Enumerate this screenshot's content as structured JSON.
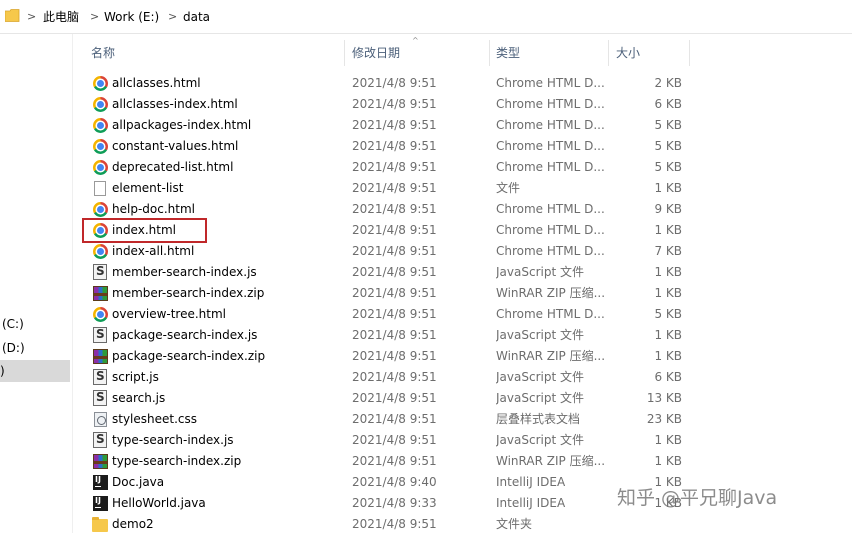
{
  "address_bar": {
    "crumbs": [
      "此电脑",
      "Work (E:)",
      "data"
    ],
    "separator": ">"
  },
  "nav_pane": {
    "items": [
      {
        "label": "(C:)",
        "selected": false
      },
      {
        "label": " (D:)",
        "selected": false
      },
      {
        "label": ")",
        "selected": true
      }
    ]
  },
  "columns": {
    "name": "名称",
    "date": "修改日期",
    "type": "类型",
    "size": "大小",
    "sort_indicator": "^"
  },
  "files": [
    {
      "name": "allclasses.html",
      "date": "2021/4/8 9:51",
      "type": "Chrome HTML D...",
      "size": "2 KB",
      "icon": "chrome-icon"
    },
    {
      "name": "allclasses-index.html",
      "date": "2021/4/8 9:51",
      "type": "Chrome HTML D...",
      "size": "6 KB",
      "icon": "chrome-icon"
    },
    {
      "name": "allpackages-index.html",
      "date": "2021/4/8 9:51",
      "type": "Chrome HTML D...",
      "size": "5 KB",
      "icon": "chrome-icon"
    },
    {
      "name": "constant-values.html",
      "date": "2021/4/8 9:51",
      "type": "Chrome HTML D...",
      "size": "5 KB",
      "icon": "chrome-icon"
    },
    {
      "name": "deprecated-list.html",
      "date": "2021/4/8 9:51",
      "type": "Chrome HTML D...",
      "size": "5 KB",
      "icon": "chrome-icon"
    },
    {
      "name": "element-list",
      "date": "2021/4/8 9:51",
      "type": "文件",
      "size": "1 KB",
      "icon": "blank-file-icon"
    },
    {
      "name": "help-doc.html",
      "date": "2021/4/8 9:51",
      "type": "Chrome HTML D...",
      "size": "9 KB",
      "icon": "chrome-icon"
    },
    {
      "name": "index.html",
      "date": "2021/4/8 9:51",
      "type": "Chrome HTML D...",
      "size": "1 KB",
      "icon": "chrome-icon",
      "highlighted": true
    },
    {
      "name": "index-all.html",
      "date": "2021/4/8 9:51",
      "type": "Chrome HTML D...",
      "size": "7 KB",
      "icon": "chrome-icon"
    },
    {
      "name": "member-search-index.js",
      "date": "2021/4/8 9:51",
      "type": "JavaScript 文件",
      "size": "1 KB",
      "icon": "javascript-file-icon"
    },
    {
      "name": "member-search-index.zip",
      "date": "2021/4/8 9:51",
      "type": "WinRAR ZIP 压缩...",
      "size": "1 KB",
      "icon": "winrar-zip-icon"
    },
    {
      "name": "overview-tree.html",
      "date": "2021/4/8 9:51",
      "type": "Chrome HTML D...",
      "size": "5 KB",
      "icon": "chrome-icon"
    },
    {
      "name": "package-search-index.js",
      "date": "2021/4/8 9:51",
      "type": "JavaScript 文件",
      "size": "1 KB",
      "icon": "javascript-file-icon"
    },
    {
      "name": "package-search-index.zip",
      "date": "2021/4/8 9:51",
      "type": "WinRAR ZIP 压缩...",
      "size": "1 KB",
      "icon": "winrar-zip-icon"
    },
    {
      "name": "script.js",
      "date": "2021/4/8 9:51",
      "type": "JavaScript 文件",
      "size": "6 KB",
      "icon": "javascript-file-icon"
    },
    {
      "name": "search.js",
      "date": "2021/4/8 9:51",
      "type": "JavaScript 文件",
      "size": "13 KB",
      "icon": "javascript-file-icon"
    },
    {
      "name": "stylesheet.css",
      "date": "2021/4/8 9:51",
      "type": "层叠样式表文档",
      "size": "23 KB",
      "icon": "css-file-icon"
    },
    {
      "name": "type-search-index.js",
      "date": "2021/4/8 9:51",
      "type": "JavaScript 文件",
      "size": "1 KB",
      "icon": "javascript-file-icon"
    },
    {
      "name": "type-search-index.zip",
      "date": "2021/4/8 9:51",
      "type": "WinRAR ZIP 压缩...",
      "size": "1 KB",
      "icon": "winrar-zip-icon"
    },
    {
      "name": "Doc.java",
      "date": "2021/4/8 9:40",
      "type": "IntelliJ IDEA",
      "size": "1 KB",
      "icon": "intellij-java-icon"
    },
    {
      "name": "HelloWorld.java",
      "date": "2021/4/8 9:33",
      "type": "IntelliJ IDEA",
      "size": "1 KB",
      "icon": "intellij-java-icon"
    },
    {
      "name": "demo2",
      "date": "2021/4/8 9:51",
      "type": "文件夹",
      "size": "",
      "icon": "folder-icon"
    }
  ],
  "watermark": "知乎 @平兄聊Java",
  "colors": {
    "highlight_border": "#c0282a",
    "header_text": "#4c607a",
    "secondary_text": "#6d6d6d"
  }
}
